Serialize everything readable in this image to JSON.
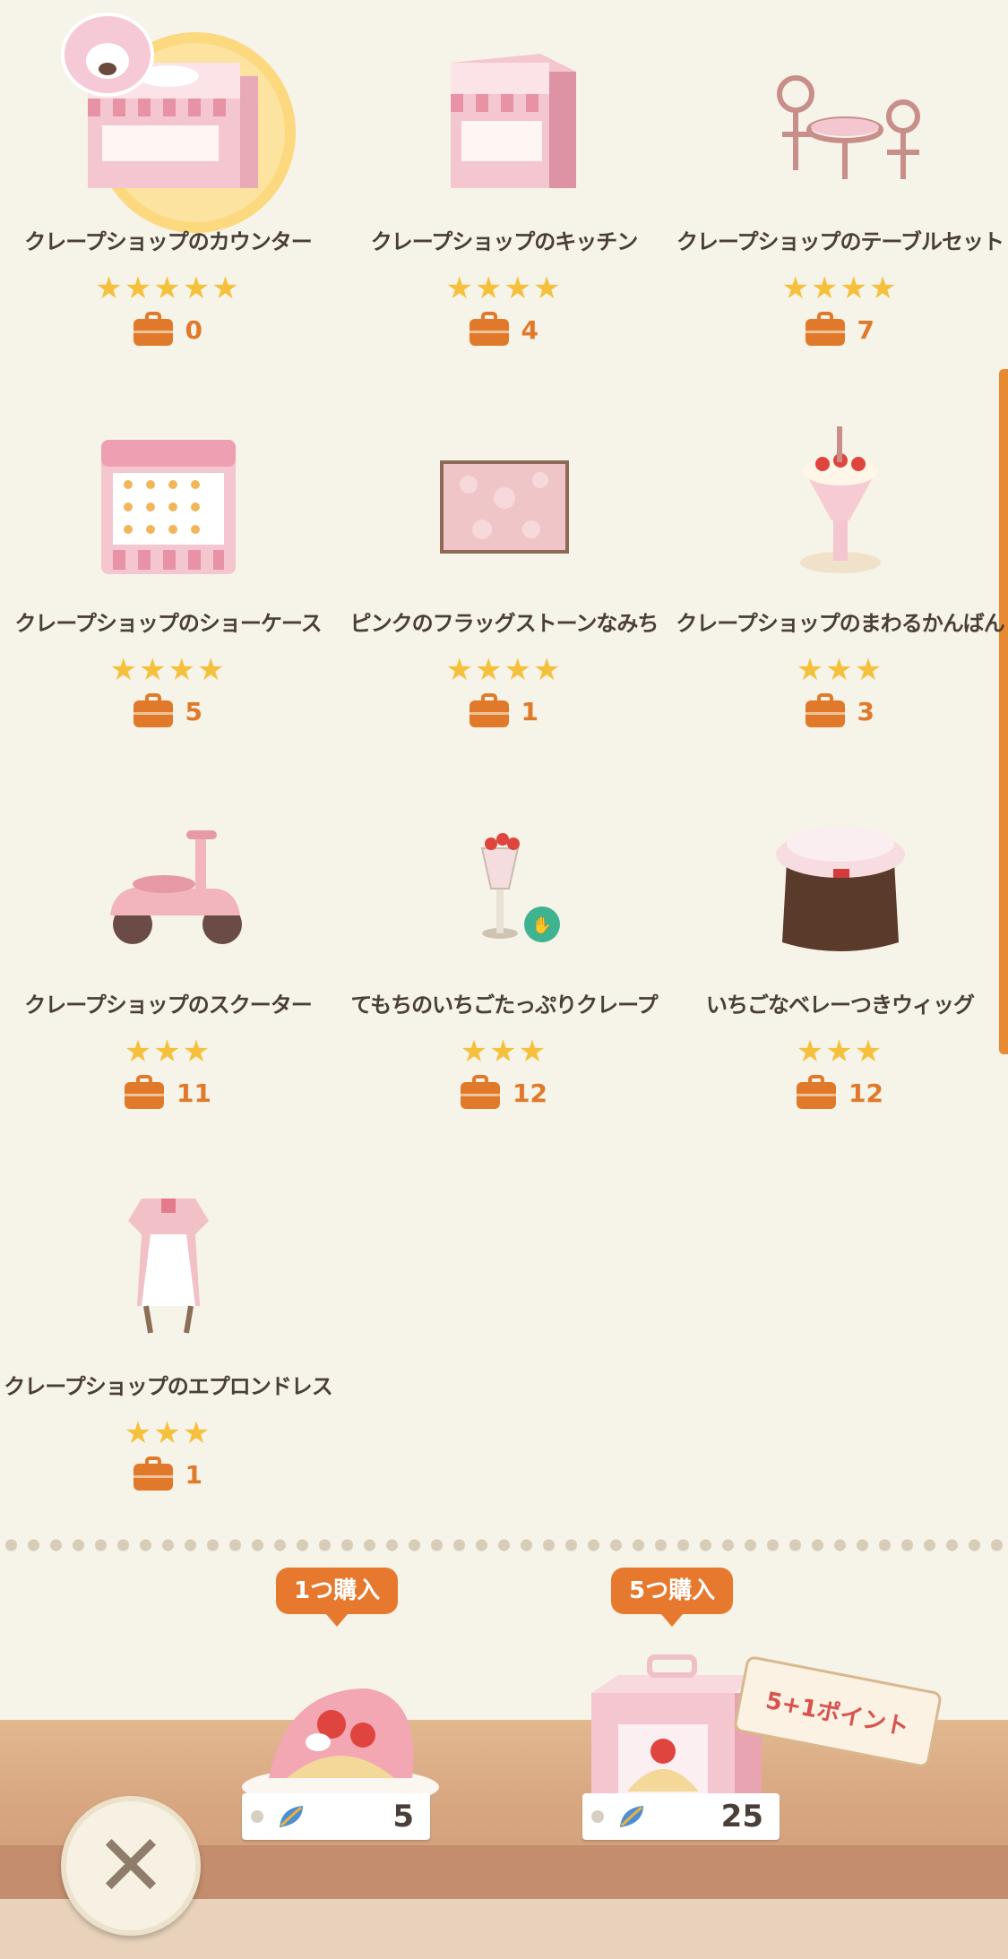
{
  "items": [
    {
      "name": "クレープショップのカウンター",
      "stars": "★★★★★",
      "count": "0",
      "icon": "counter-icon"
    },
    {
      "name": "クレープショップのキッチン",
      "stars": "★★★★",
      "count": "4",
      "icon": "kitchen-icon"
    },
    {
      "name": "クレープショップのテーブルセット",
      "stars": "★★★★",
      "count": "7",
      "icon": "table-set-icon"
    },
    {
      "name": "クレープショップのショーケース",
      "stars": "★★★★",
      "count": "5",
      "icon": "showcase-icon"
    },
    {
      "name": "ピンクのフラッグストーンなみち",
      "stars": "★★★★",
      "count": "1",
      "icon": "flagstone-icon"
    },
    {
      "name": "クレープショップのまわるかんばん",
      "stars": "★★★",
      "count": "3",
      "icon": "sign-icon"
    },
    {
      "name": "クレープショップのスクーター",
      "stars": "★★★",
      "count": "11",
      "icon": "scooter-icon"
    },
    {
      "name": "てもちのいちごたっぷりクレープ",
      "stars": "★★★",
      "count": "12",
      "icon": "crepe-parfait-icon"
    },
    {
      "name": "いちごなベレーつきウィッグ",
      "stars": "★★★",
      "count": "12",
      "icon": "wig-icon"
    },
    {
      "name": "クレープショップのエプロンドレス",
      "stars": "★★★",
      "count": "1",
      "icon": "apron-dress-icon"
    }
  ],
  "offers": {
    "single": {
      "label": "1つ購入",
      "price": "5",
      "icon": "crepe-icon"
    },
    "bundle": {
      "label": "5つ購入",
      "price": "25",
      "bonus": "5+1ポイント",
      "icon": "crepe-box-icon"
    }
  },
  "colors": {
    "accent": "#e6792e",
    "star": "#f5c13d",
    "background": "#f6f3e9"
  }
}
